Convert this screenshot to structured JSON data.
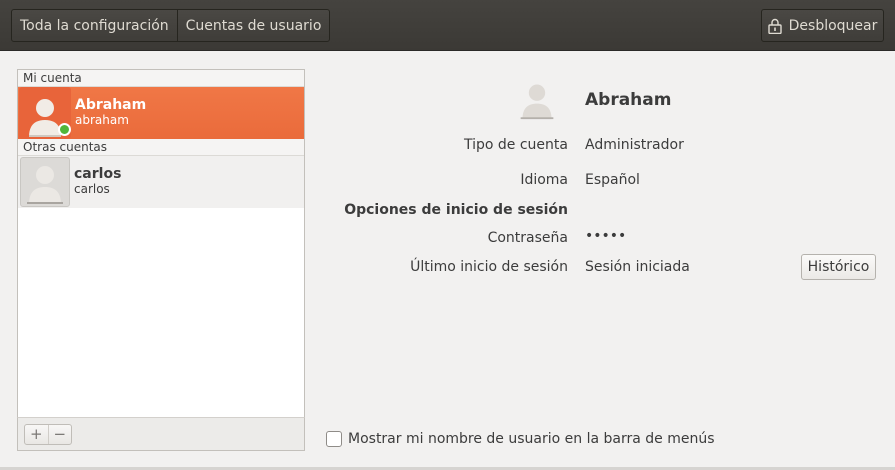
{
  "header": {
    "crumbs": [
      "Toda la configuración",
      "Cuentas de usuario"
    ],
    "unlock_label": "Desbloquear",
    "unlock_icon": "lock-icon"
  },
  "sidebar": {
    "my_account_label": "Mi cuenta",
    "other_accounts_label": "Otras cuentas",
    "users": [
      {
        "name": "Abraham",
        "login": "abraham",
        "selected": true,
        "online": true
      },
      {
        "name": "carlos",
        "login": "carlos",
        "selected": false,
        "online": false
      }
    ],
    "add_label": "+",
    "remove_label": "−"
  },
  "detail": {
    "name": "Abraham",
    "account_type_label": "Tipo de cuenta",
    "account_type_value": "Administrador",
    "language_label": "Idioma",
    "language_value": "Español",
    "login_options_heading": "Opciones de inicio de sesión",
    "password_label": "Contraseña",
    "password_value": "•••••",
    "last_login_label": "Último inicio de sesión",
    "last_login_value": "Sesión iniciada",
    "history_button": "Histórico"
  },
  "footer": {
    "show_username_label": "Mostrar mi nombre de usuario en la barra de menús",
    "show_username_checked": false
  },
  "colors": {
    "selection": "#f07746",
    "online": "#52b63a",
    "headerbar": "#3f3d39"
  }
}
